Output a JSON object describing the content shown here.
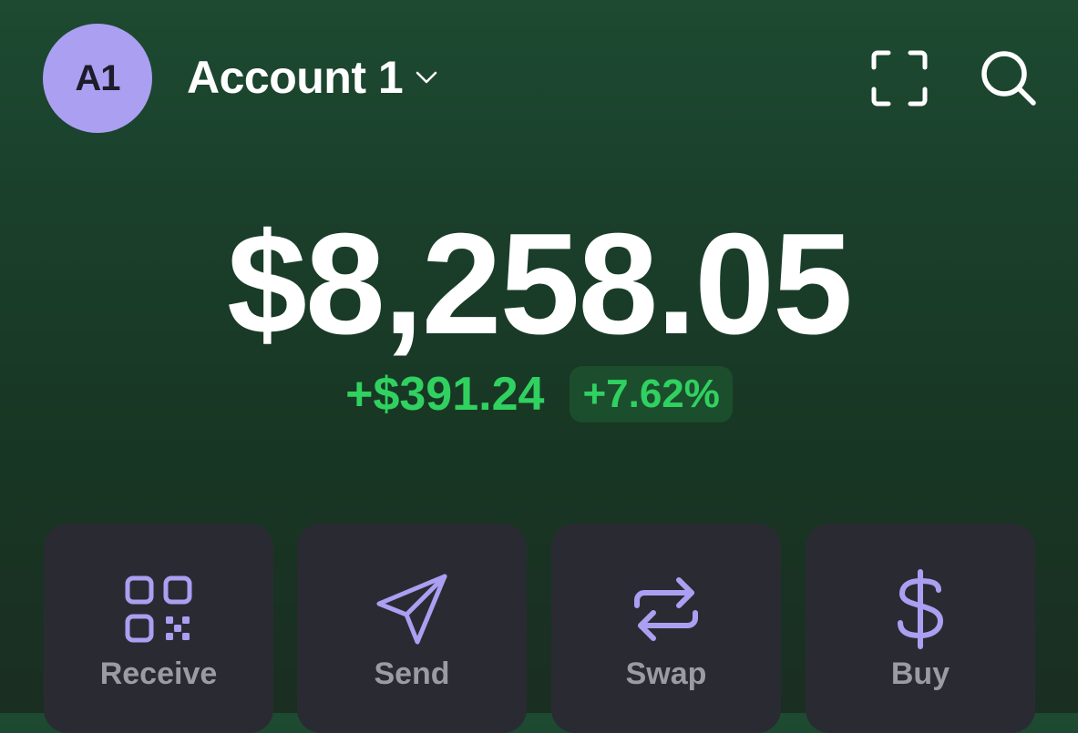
{
  "header": {
    "avatar_initials": "A1",
    "account_name": "Account 1",
    "icons": [
      "scan-icon",
      "search-icon"
    ]
  },
  "balance": {
    "total": "$8,258.05",
    "change_amount": "+$391.24",
    "change_percent": "+7.62%"
  },
  "actions": [
    {
      "label": "Receive",
      "icon": "qr-code-icon"
    },
    {
      "label": "Send",
      "icon": "send-icon"
    },
    {
      "label": "Swap",
      "icon": "swap-icon"
    },
    {
      "label": "Buy",
      "icon": "dollar-icon"
    }
  ],
  "colors": {
    "accent_purple": "#ab9ff2",
    "positive_green": "#30d160",
    "card_bg": "#2a2b32"
  }
}
